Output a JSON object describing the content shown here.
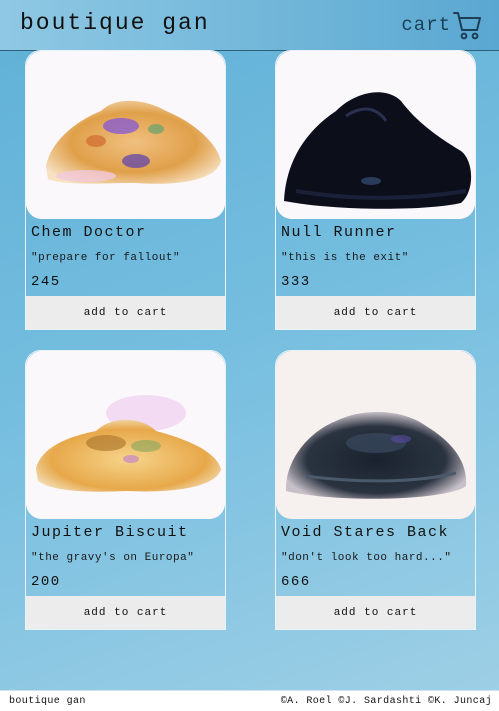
{
  "header": {
    "brand": "boutique gan",
    "cart_label": "cart",
    "cart_icon": "shopping-cart-icon"
  },
  "products": [
    {
      "name": "Chem Doctor",
      "tagline": "\"prepare for fallout\"",
      "price": "245",
      "button": "add to cart"
    },
    {
      "name": "Null Runner",
      "tagline": "\"this is the exit\"",
      "price": "333",
      "button": "add to cart"
    },
    {
      "name": "Jupiter Biscuit",
      "tagline": "\"the gravy's on Europa\"",
      "price": "200",
      "button": "add to cart"
    },
    {
      "name": "Void Stares Back",
      "tagline": "\"don't look too hard...\"",
      "price": "666",
      "button": "add to cart"
    }
  ],
  "footer": {
    "left": "boutique gan",
    "right": "©A. Roel ©J. Sardashti ©K. Juncaj"
  },
  "colors": {
    "background": "#74bddf",
    "header": "#6fb5d8",
    "button": "#ececec"
  }
}
